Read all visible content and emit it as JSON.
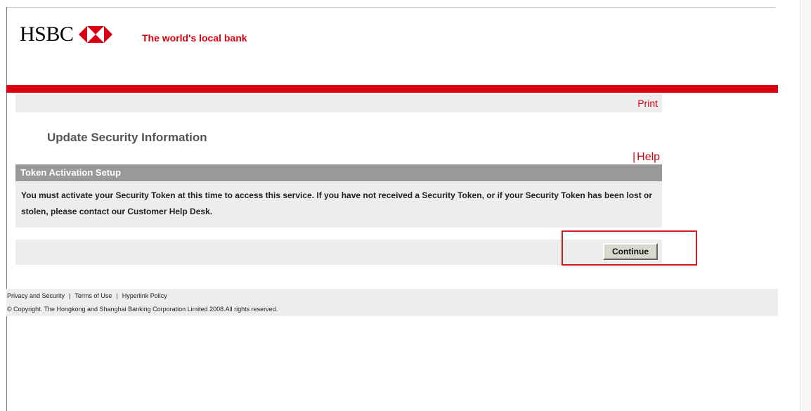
{
  "header": {
    "logo_text": "HSBC",
    "tagline": "The world's local bank",
    "brand_color": "#db0011"
  },
  "toolbar": {
    "print_label": "Print"
  },
  "page": {
    "title": "Update Security Information",
    "help_separator": "|",
    "help_label": "Help"
  },
  "section": {
    "header": "Token Activation Setup",
    "message": "You must activate your Security Token at this time to access this service. If you have not received a Security Token, or if your Security Token has been lost or stolen, please contact our Customer Help Desk."
  },
  "actions": {
    "continue_label": "Continue"
  },
  "footer": {
    "links": [
      "Privacy and Security",
      "Terms of Use",
      "Hyperlink Policy"
    ],
    "separator": "|",
    "copyright": "© Copyright. The Hongkong and Shanghai Banking Corporation Limited 2008.All rights reserved."
  },
  "icons": {
    "logo": "hsbc-hexagon-icon"
  }
}
